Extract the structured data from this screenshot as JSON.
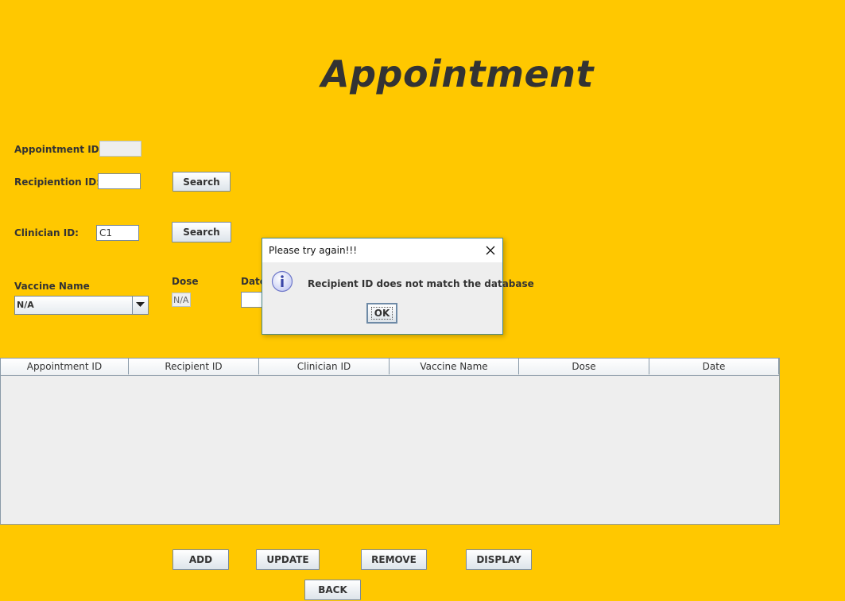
{
  "page": {
    "title": "Appointment"
  },
  "form": {
    "appointment_id_label": "Appointment ID:",
    "appointment_id_value": "",
    "recipient_id_label": "Recipiention ID:",
    "recipient_id_value": "",
    "recipient_search_label": "Search",
    "clinician_id_label": "Clinician ID:",
    "clinician_id_value": "C1",
    "clinician_search_label": "Search",
    "vaccine_name_label": "Vaccine Name",
    "vaccine_name_selected": "N/A",
    "dose_label": "Dose",
    "dose_value": "N/A",
    "date_label": "Date",
    "date_value": ""
  },
  "table": {
    "columns": [
      "Appointment ID",
      "Recipient ID",
      "Clinician ID",
      "Vaccine Name",
      "Dose",
      "Date"
    ],
    "rows": []
  },
  "actions": {
    "add_label": "ADD",
    "update_label": "UPDATE",
    "remove_label": "REMOVE",
    "display_label": "DISPLAY",
    "back_label": "BACK"
  },
  "dialog": {
    "title": "Please try again!!!",
    "message": "Recipient ID does not match the database",
    "ok_label": "OK",
    "icon": "info-icon"
  },
  "colors": {
    "background": "#ffc800",
    "dialog_border": "#4a8a8a"
  }
}
